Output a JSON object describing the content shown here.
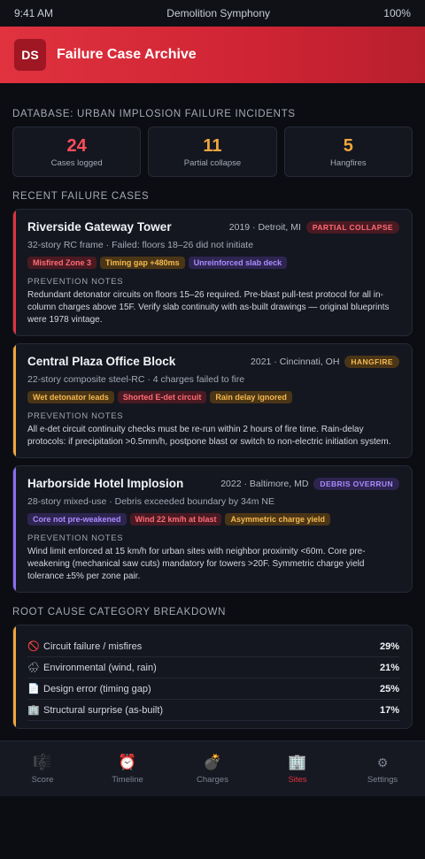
{
  "status_bar": {
    "time": "9:41 AM",
    "title": "Demolition Symphony",
    "battery": "100%"
  },
  "header": {
    "logo": "DS",
    "title": "Failure Case Archive"
  },
  "database": {
    "label": "DATABASE: URBAN IMPLOSION FAILURE INCIDENTS",
    "stats": [
      {
        "value": "24",
        "label": "Cases logged",
        "color": "#ff4d5a"
      },
      {
        "value": "11",
        "label": "Partial collapse",
        "color": "#f0a63c"
      },
      {
        "value": "5",
        "label": "Hangfires",
        "color": "#f0a63c"
      }
    ]
  },
  "recent": {
    "label": "RECENT FAILURE CASES",
    "prevention_label": "PREVENTION NOTES",
    "cases": [
      {
        "title": "Riverside Gateway Tower",
        "meta": "2019 · Detroit, MI",
        "status": "PARTIAL COLLAPSE",
        "accent": "#e0323f",
        "status_bg": "#4a1a22",
        "status_fg": "#ff6b75",
        "desc": "32-story RC frame · Failed: floors 18–26 did not initiate",
        "tags": [
          {
            "text": "Misfired Zone 3",
            "bg": "#4a1a22",
            "fg": "#ff6b75"
          },
          {
            "text": "Timing gap +480ms",
            "bg": "#4a3516",
            "fg": "#f5b94e"
          },
          {
            "text": "Unreinforced slab deck",
            "bg": "#2e2450",
            "fg": "#a98cff"
          }
        ],
        "notes": "Redundant detonator circuits on floors 15–26 required. Pre-blast pull-test protocol for all in-column charges above 15F. Verify slab continuity with as-built drawings — original blueprints were 1978 vintage."
      },
      {
        "title": "Central Plaza Office Block",
        "meta": "2021 · Cincinnati, OH",
        "status": "HANGFIRE",
        "accent": "#f0a63c",
        "status_bg": "#4a3516",
        "status_fg": "#f5b94e",
        "desc": "22-story composite steel-RC · 4 charges failed to fire",
        "tags": [
          {
            "text": "Wet detonator leads",
            "bg": "#4a3516",
            "fg": "#f5b94e"
          },
          {
            "text": "Shorted E-det circuit",
            "bg": "#4a1a22",
            "fg": "#ff6b75"
          },
          {
            "text": "Rain delay ignored",
            "bg": "#4a3516",
            "fg": "#f5b94e"
          }
        ],
        "notes": "All e-det circuit continuity checks must be re-run within 2 hours of fire time. Rain-delay protocols: if precipitation >0.5mm/h, postpone blast or switch to non-electric initiation system."
      },
      {
        "title": "Harborside Hotel Implosion",
        "meta": "2022 · Baltimore, MD",
        "status": "DEBRIS OVERRUN",
        "accent": "#8b6cf0",
        "status_bg": "#2e2450",
        "status_fg": "#a98cff",
        "desc": "28-story mixed-use · Debris exceeded boundary by 34m NE",
        "tags": [
          {
            "text": "Core not pre-weakened",
            "bg": "#2e2450",
            "fg": "#a98cff"
          },
          {
            "text": "Wind 22 km/h at blast",
            "bg": "#4a1a22",
            "fg": "#ff6b75"
          },
          {
            "text": "Asymmetric charge yield",
            "bg": "#4a3516",
            "fg": "#f5b94e"
          }
        ],
        "notes": "Wind limit enforced at 15 km/h for urban sites with neighbor proximity <60m. Core pre-weakening (mechanical saw cuts) mandatory for towers >20F. Symmetric charge yield tolerance ±5% per zone pair."
      }
    ]
  },
  "root_cause": {
    "label": "ROOT CAUSE CATEGORY BREAKDOWN",
    "rows": [
      {
        "icon": "prohibited-icon",
        "glyph": "🚫",
        "label": "Circuit failure / misfires",
        "pct": "29%"
      },
      {
        "icon": "cloud-rain-icon",
        "glyph": "🌧",
        "label": "Environmental (wind, rain)",
        "pct": "21%"
      },
      {
        "icon": "document-icon",
        "glyph": "📄",
        "label": "Design error (timing gap)",
        "pct": "25%"
      },
      {
        "icon": "building-icon",
        "glyph": "🏢",
        "label": "Structural surprise (as-built)",
        "pct": "17%"
      },
      {
        "icon": "misc-icon",
        "glyph": "•",
        "label": "",
        "pct": ""
      }
    ]
  },
  "tabs": [
    {
      "name": "score",
      "icon": "music-score-icon",
      "glyph": "🎼",
      "label": "Score",
      "active": false
    },
    {
      "name": "timeline",
      "icon": "alarm-clock-icon",
      "glyph": "⏰",
      "label": "Timeline",
      "active": false
    },
    {
      "name": "charges",
      "icon": "bomb-icon",
      "glyph": "💣",
      "label": "Charges",
      "active": false
    },
    {
      "name": "sites",
      "icon": "buildings-icon",
      "glyph": "🏢",
      "label": "Sites",
      "active": true
    },
    {
      "name": "settings",
      "icon": "gear-icon",
      "glyph": "⚙",
      "label": "Settings",
      "active": false
    }
  ]
}
